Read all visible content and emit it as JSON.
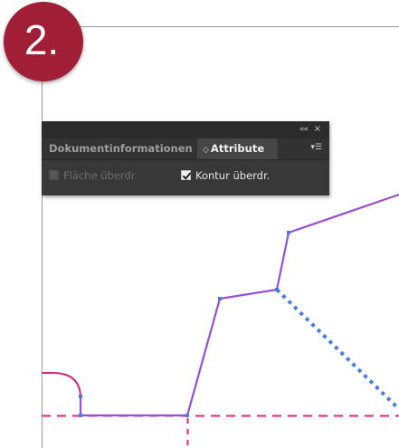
{
  "step_badge": {
    "label": "2.",
    "color": "#a01e36"
  },
  "canvas": {
    "background": "#ffffff",
    "path_color": "#9a4fd0",
    "dashed_color": "#e8207e",
    "anchor_color": "#4a7de0"
  },
  "panel": {
    "collapse_icon": "double-chevron-left-icon",
    "collapse_label": "««",
    "close_icon": "close-icon",
    "close_label": "×",
    "tabs": [
      {
        "label": "Dokumentinformationen",
        "active": false
      },
      {
        "label": "Attribute",
        "active": true,
        "prefix_icon": "up-down-arrows-icon",
        "prefix": "◇"
      }
    ],
    "menu_icon": "panel-menu-icon",
    "menu_label": "▾☰",
    "options": {
      "fill_overprint": {
        "label": "Fläche überdr.",
        "checked": false,
        "enabled": false
      },
      "stroke_overprint": {
        "label": "Kontur überdr.",
        "checked": true,
        "enabled": true
      }
    }
  }
}
